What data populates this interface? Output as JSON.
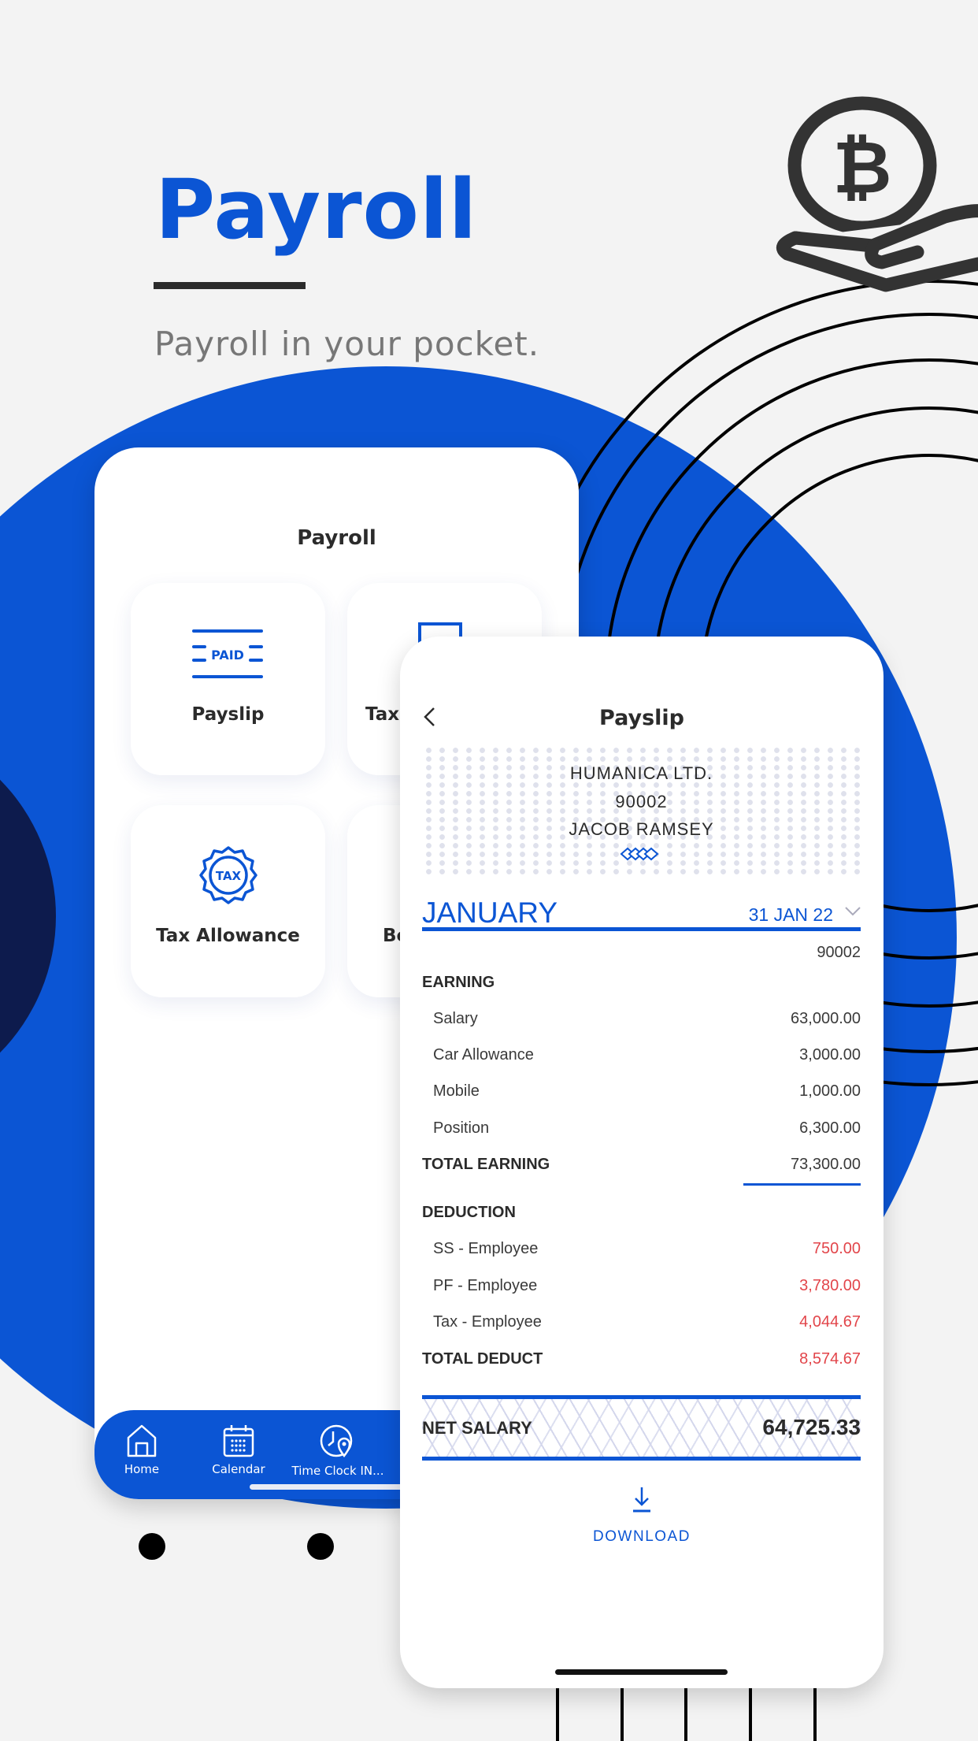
{
  "hero": {
    "title": "Payroll",
    "subtitle": "Payroll in your pocket."
  },
  "colors": {
    "brand_blue": "#0b55d4",
    "dark_navy": "#0d1b4d",
    "deduction_red": "#e2454a"
  },
  "decor_icons": [
    "bitcoin-hand-icon"
  ],
  "payroll_screen": {
    "title": "Payroll",
    "tiles": [
      {
        "label": "Payslip",
        "icon": "paid-icon"
      },
      {
        "label": "Tax",
        "icon": "document-icon"
      },
      {
        "label": "Tax Allowance",
        "icon": "tax-badge-icon"
      },
      {
        "label": "Be",
        "icon": ""
      }
    ],
    "nav": [
      {
        "label": "Home",
        "icon": "home-icon"
      },
      {
        "label": "Calendar",
        "icon": "calendar-icon"
      },
      {
        "label": "Time Clock IN...",
        "icon": "time-clock-location-icon"
      }
    ]
  },
  "payslip_screen": {
    "title": "Payslip",
    "company": "HUMANICA LTD.",
    "employee_id": "90002",
    "employee_name": "JACOB RAMSEY",
    "month": "JANUARY",
    "date": "31 JAN 22",
    "ref": "90002",
    "earning": {
      "heading": "EARNING",
      "items": [
        {
          "label": "Salary",
          "value": "63,000.00"
        },
        {
          "label": "Car Allowance",
          "value": "3,000.00"
        },
        {
          "label": "Mobile",
          "value": "1,000.00"
        },
        {
          "label": "Position",
          "value": "6,300.00"
        }
      ],
      "total_label": "TOTAL EARNING",
      "total_value": "73,300.00"
    },
    "deduction": {
      "heading": "DEDUCTION",
      "items": [
        {
          "label": "SS - Employee",
          "value": "750.00"
        },
        {
          "label": "PF - Employee",
          "value": "3,780.00"
        },
        {
          "label": "Tax - Employee",
          "value": "4,044.67"
        }
      ],
      "total_label": "TOTAL DEDUCT",
      "total_value": "8,574.67"
    },
    "net_label": "NET SALARY",
    "net_value": "64,725.33",
    "download_label": "DOWNLOAD"
  }
}
